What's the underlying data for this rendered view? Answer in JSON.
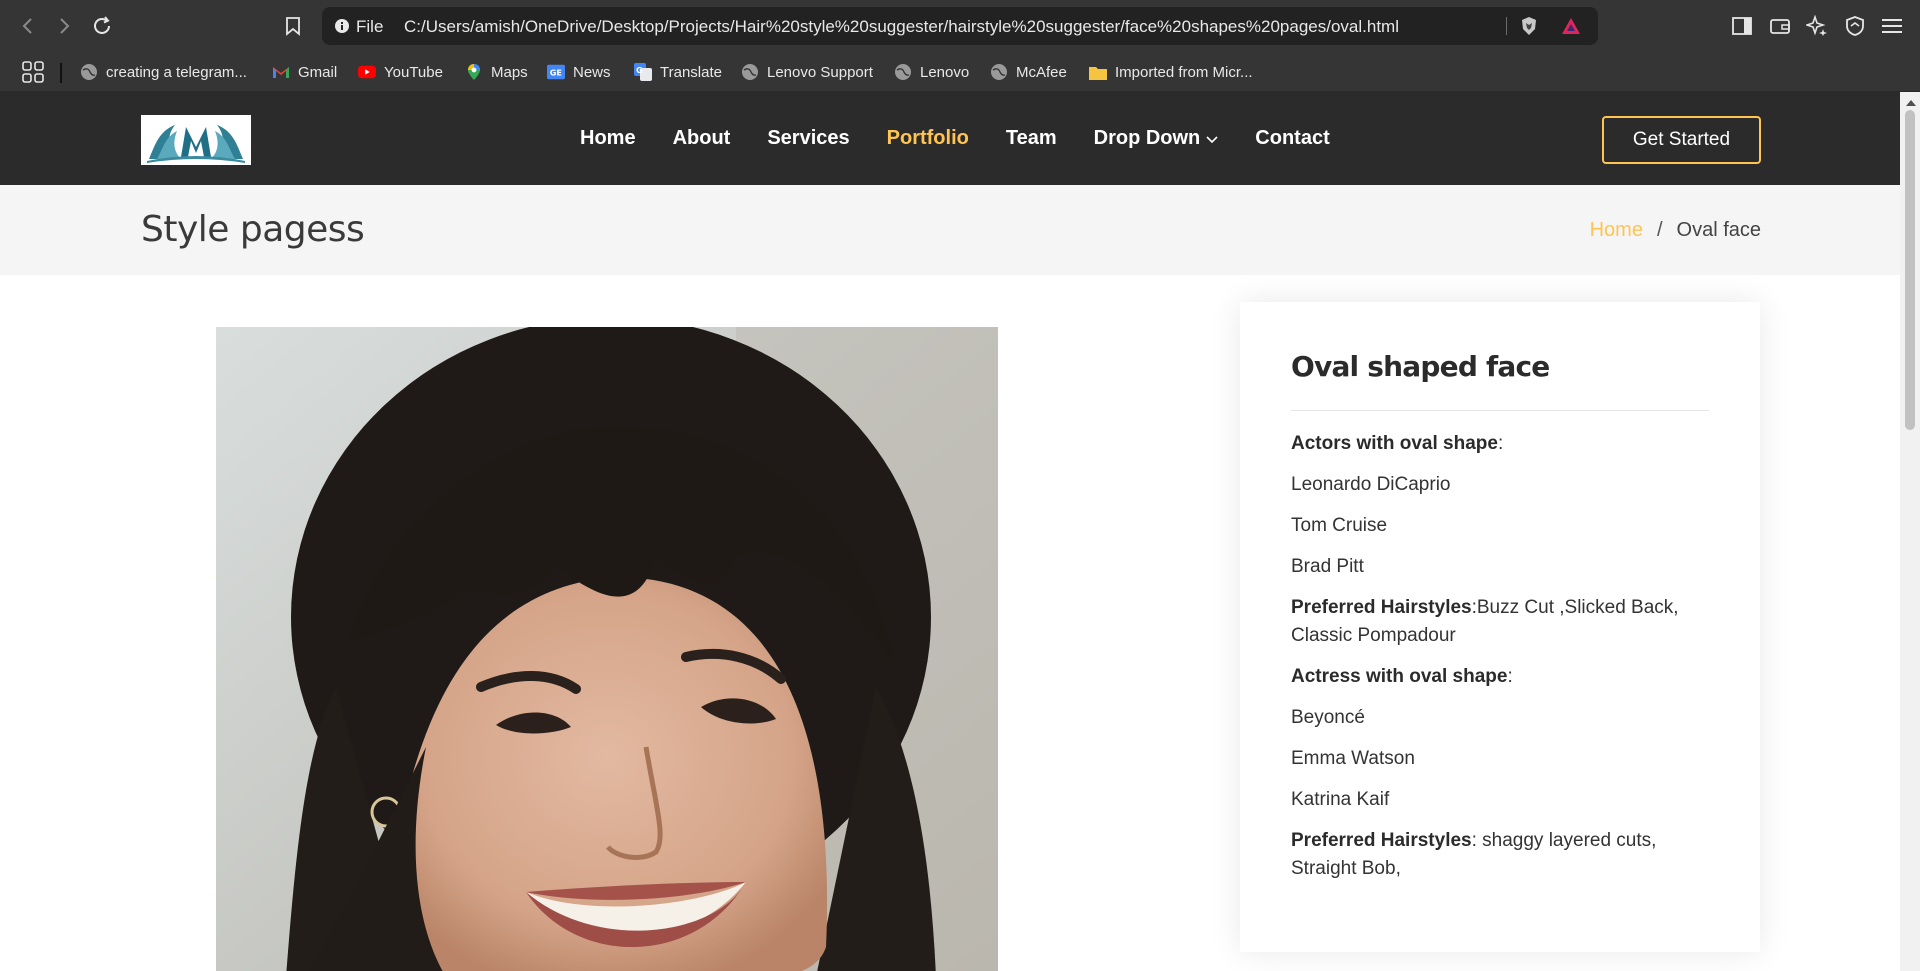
{
  "browser": {
    "url_scheme": "File",
    "url": "C:/Users/amish/OneDrive/Desktop/Projects/Hair%20style%20suggester/hairstyle%20suggester/face%20shapes%20pages/oval.html",
    "bookmarks": [
      {
        "label": "creating a telegram...",
        "icon": "globe-icon"
      },
      {
        "label": "Gmail",
        "icon": "gmail-icon"
      },
      {
        "label": "YouTube",
        "icon": "youtube-icon"
      },
      {
        "label": "Maps",
        "icon": "maps-icon"
      },
      {
        "label": "News",
        "icon": "news-icon"
      },
      {
        "label": "Translate",
        "icon": "translate-icon"
      },
      {
        "label": "Lenovo Support",
        "icon": "globe-icon"
      },
      {
        "label": "Lenovo",
        "icon": "globe-icon"
      },
      {
        "label": "McAfee",
        "icon": "globe-icon"
      },
      {
        "label": "Imported from Micr...",
        "icon": "folder-icon"
      }
    ]
  },
  "nav": {
    "items": [
      {
        "label": "Home"
      },
      {
        "label": "About"
      },
      {
        "label": "Services"
      },
      {
        "label": "Portfolio",
        "active": true
      },
      {
        "label": "Team"
      },
      {
        "label": "Drop Down"
      },
      {
        "label": "Contact"
      }
    ],
    "cta_label": "Get Started"
  },
  "breadcrumb": {
    "title": "Style pagess",
    "home": "Home",
    "separator": "/",
    "current": "Oval face"
  },
  "info": {
    "title": "Oval shaped face",
    "actors_label": "Actors with oval shape",
    "actors_suffix": ":",
    "actors": [
      "Leonardo DiCaprio",
      "Tom Cruise",
      "Brad Pitt"
    ],
    "actor_styles_label": "Preferred Hairstyles",
    "actor_styles": ":Buzz Cut ,Slicked Back, Classic Pompadour",
    "actresses_label": "Actress with oval shape",
    "actresses_suffix": ":",
    "actresses": [
      "Beyoncé",
      "Emma Watson",
      "Katrina Kaif"
    ],
    "actress_styles_label": "Preferred Hairstyles",
    "actress_styles": ": shaggy layered cuts, Straight Bob,"
  },
  "colors": {
    "accent": "#ffc451",
    "header_bg": "#2b2b2b",
    "breadcrumb_bg": "#f5f5f5",
    "browser_bg": "#353535"
  }
}
